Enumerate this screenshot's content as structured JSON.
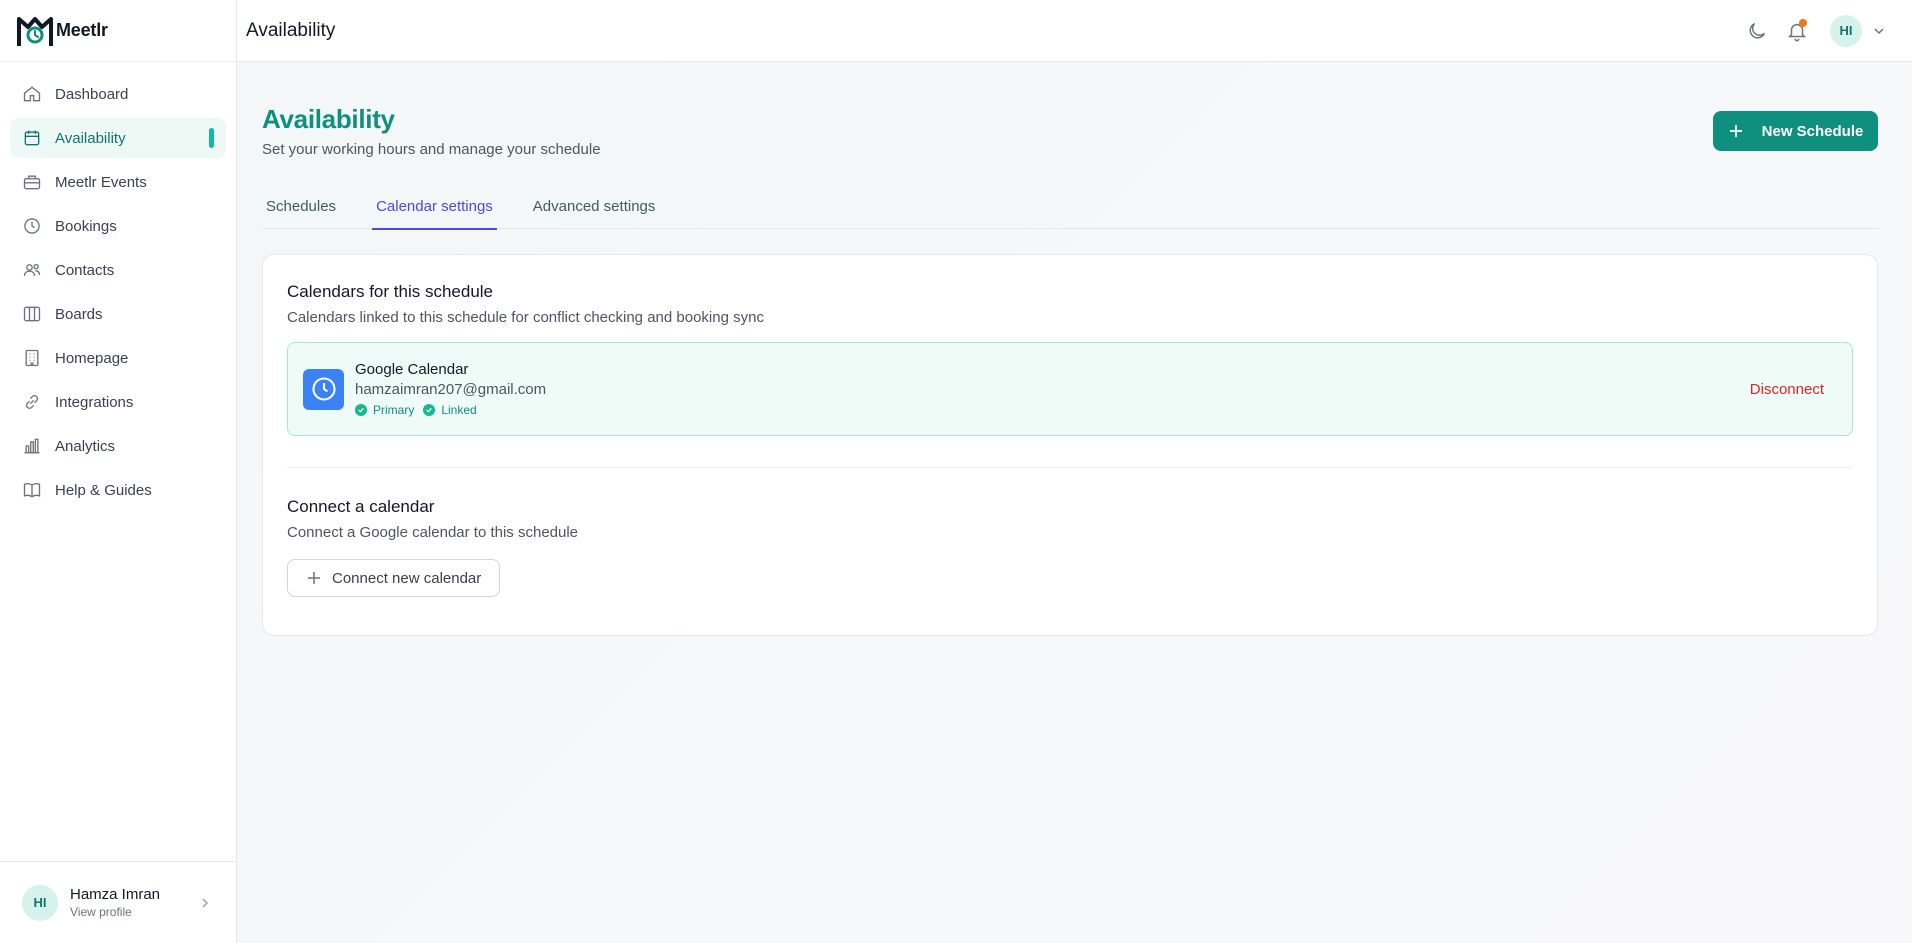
{
  "app": {
    "name": "Meetlr"
  },
  "sidebar": {
    "items": [
      {
        "label": "Dashboard",
        "icon": "home-icon"
      },
      {
        "label": "Availability",
        "icon": "calendar-icon",
        "active": true
      },
      {
        "label": "Meetlr Events",
        "icon": "briefcase-icon"
      },
      {
        "label": "Bookings",
        "icon": "clock-icon"
      },
      {
        "label": "Contacts",
        "icon": "users-icon"
      },
      {
        "label": "Boards",
        "icon": "columns-icon"
      },
      {
        "label": "Homepage",
        "icon": "building-icon"
      },
      {
        "label": "Integrations",
        "icon": "link-icon"
      },
      {
        "label": "Analytics",
        "icon": "bar-chart-icon"
      },
      {
        "label": "Help & Guides",
        "icon": "book-icon"
      }
    ],
    "profile": {
      "initials": "HI",
      "name": "Hamza Imran",
      "sub": "View profile"
    }
  },
  "topbar": {
    "title": "Availability",
    "avatar_initials": "HI"
  },
  "page": {
    "title": "Availability",
    "subtitle": "Set your working hours and manage your schedule",
    "new_button": "New Schedule"
  },
  "tabs": [
    {
      "label": "Schedules"
    },
    {
      "label": "Calendar settings",
      "active": true
    },
    {
      "label": "Advanced settings"
    }
  ],
  "calendars": {
    "title": "Calendars for this schedule",
    "subtitle": "Calendars linked to this schedule for conflict checking and booking sync",
    "items": [
      {
        "name": "Google Calendar",
        "email": "hamzaimran207@gmail.com",
        "badges": [
          "Primary",
          "Linked"
        ],
        "action": "Disconnect"
      }
    ]
  },
  "connect": {
    "title": "Connect a calendar",
    "subtitle": "Connect a Google calendar to this schedule",
    "button": "Connect new calendar"
  },
  "colors": {
    "brand": "#0f8f7e",
    "accent_tab": "#4f46e5",
    "danger": "#dc2626",
    "notification": "#f97316"
  }
}
